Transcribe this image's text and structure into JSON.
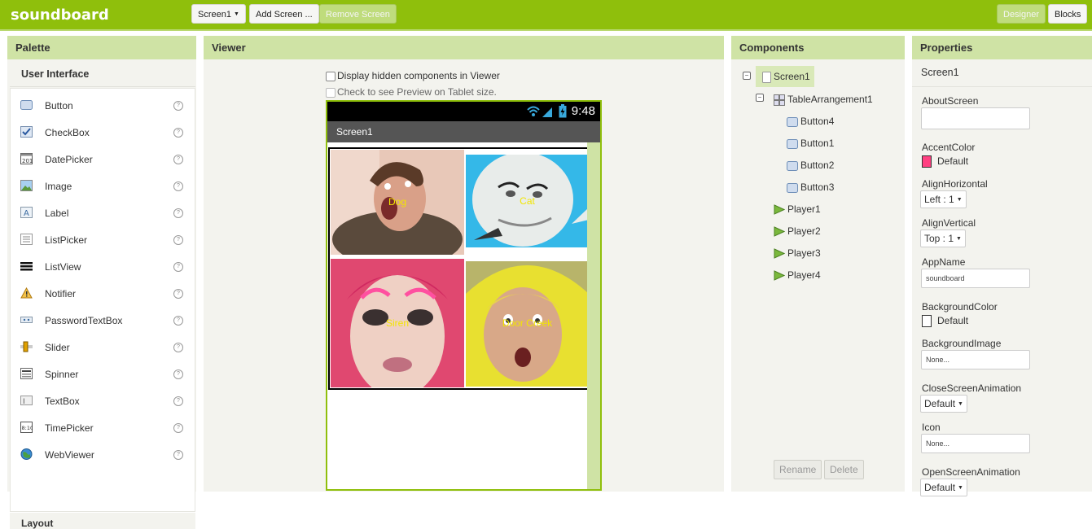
{
  "app": {
    "title": "soundboard"
  },
  "toolbar": {
    "screen_select": "Screen1",
    "add_screen": "Add Screen ...",
    "remove_screen": "Remove Screen",
    "designer": "Designer",
    "blocks": "Blocks"
  },
  "palette": {
    "header": "Palette",
    "category": "User Interface",
    "next_category": "Layout",
    "help_glyph": "?",
    "items": [
      {
        "label": "Button",
        "icon": "button-icon"
      },
      {
        "label": "CheckBox",
        "icon": "checkbox-icon"
      },
      {
        "label": "DatePicker",
        "icon": "datepicker-icon"
      },
      {
        "label": "Image",
        "icon": "image-icon"
      },
      {
        "label": "Label",
        "icon": "label-icon"
      },
      {
        "label": "ListPicker",
        "icon": "listpicker-icon"
      },
      {
        "label": "ListView",
        "icon": "listview-icon"
      },
      {
        "label": "Notifier",
        "icon": "notifier-icon"
      },
      {
        "label": "PasswordTextBox",
        "icon": "password-icon"
      },
      {
        "label": "Slider",
        "icon": "slider-icon"
      },
      {
        "label": "Spinner",
        "icon": "spinner-icon"
      },
      {
        "label": "TextBox",
        "icon": "textbox-icon"
      },
      {
        "label": "TimePicker",
        "icon": "timepicker-icon"
      },
      {
        "label": "WebViewer",
        "icon": "webviewer-icon"
      }
    ]
  },
  "viewer": {
    "header": "Viewer",
    "display_hidden": "Display hidden components in Viewer",
    "tablet_preview": "Check to see Preview on Tablet size.",
    "phone": {
      "time": "9:48",
      "screen_title": "Screen1",
      "buttons": [
        "Dog",
        "Cat",
        "Siren",
        "Door Creek"
      ]
    }
  },
  "components": {
    "header": "Components",
    "tree": {
      "screen": "Screen1",
      "arrangement": "TableArrangement1",
      "buttons": [
        "Button4",
        "Button1",
        "Button2",
        "Button3"
      ],
      "players": [
        "Player1",
        "Player2",
        "Player3",
        "Player4"
      ]
    },
    "rename": "Rename",
    "delete": "Delete"
  },
  "properties": {
    "header": "Properties",
    "screen": "Screen1",
    "about_screen": {
      "label": "AboutScreen",
      "value": ""
    },
    "accent_color": {
      "label": "AccentColor",
      "value": "Default",
      "color": "#ff4081"
    },
    "align_horizontal": {
      "label": "AlignHorizontal",
      "value": "Left : 1"
    },
    "align_vertical": {
      "label": "AlignVertical",
      "value": "Top : 1"
    },
    "app_name": {
      "label": "AppName",
      "value": "soundboard"
    },
    "background_color": {
      "label": "BackgroundColor",
      "value": "Default",
      "color": "#ffffff"
    },
    "background_image": {
      "label": "BackgroundImage",
      "value": "None..."
    },
    "close_animation": {
      "label": "CloseScreenAnimation",
      "value": "Default"
    },
    "icon": {
      "label": "Icon",
      "value": "None..."
    },
    "open_animation": {
      "label": "OpenScreenAnimation",
      "value": "Default"
    }
  },
  "colors": {
    "accent_green": "#8fbf0c",
    "header_green": "#cfe3a5",
    "button_text": "#f2e600"
  }
}
